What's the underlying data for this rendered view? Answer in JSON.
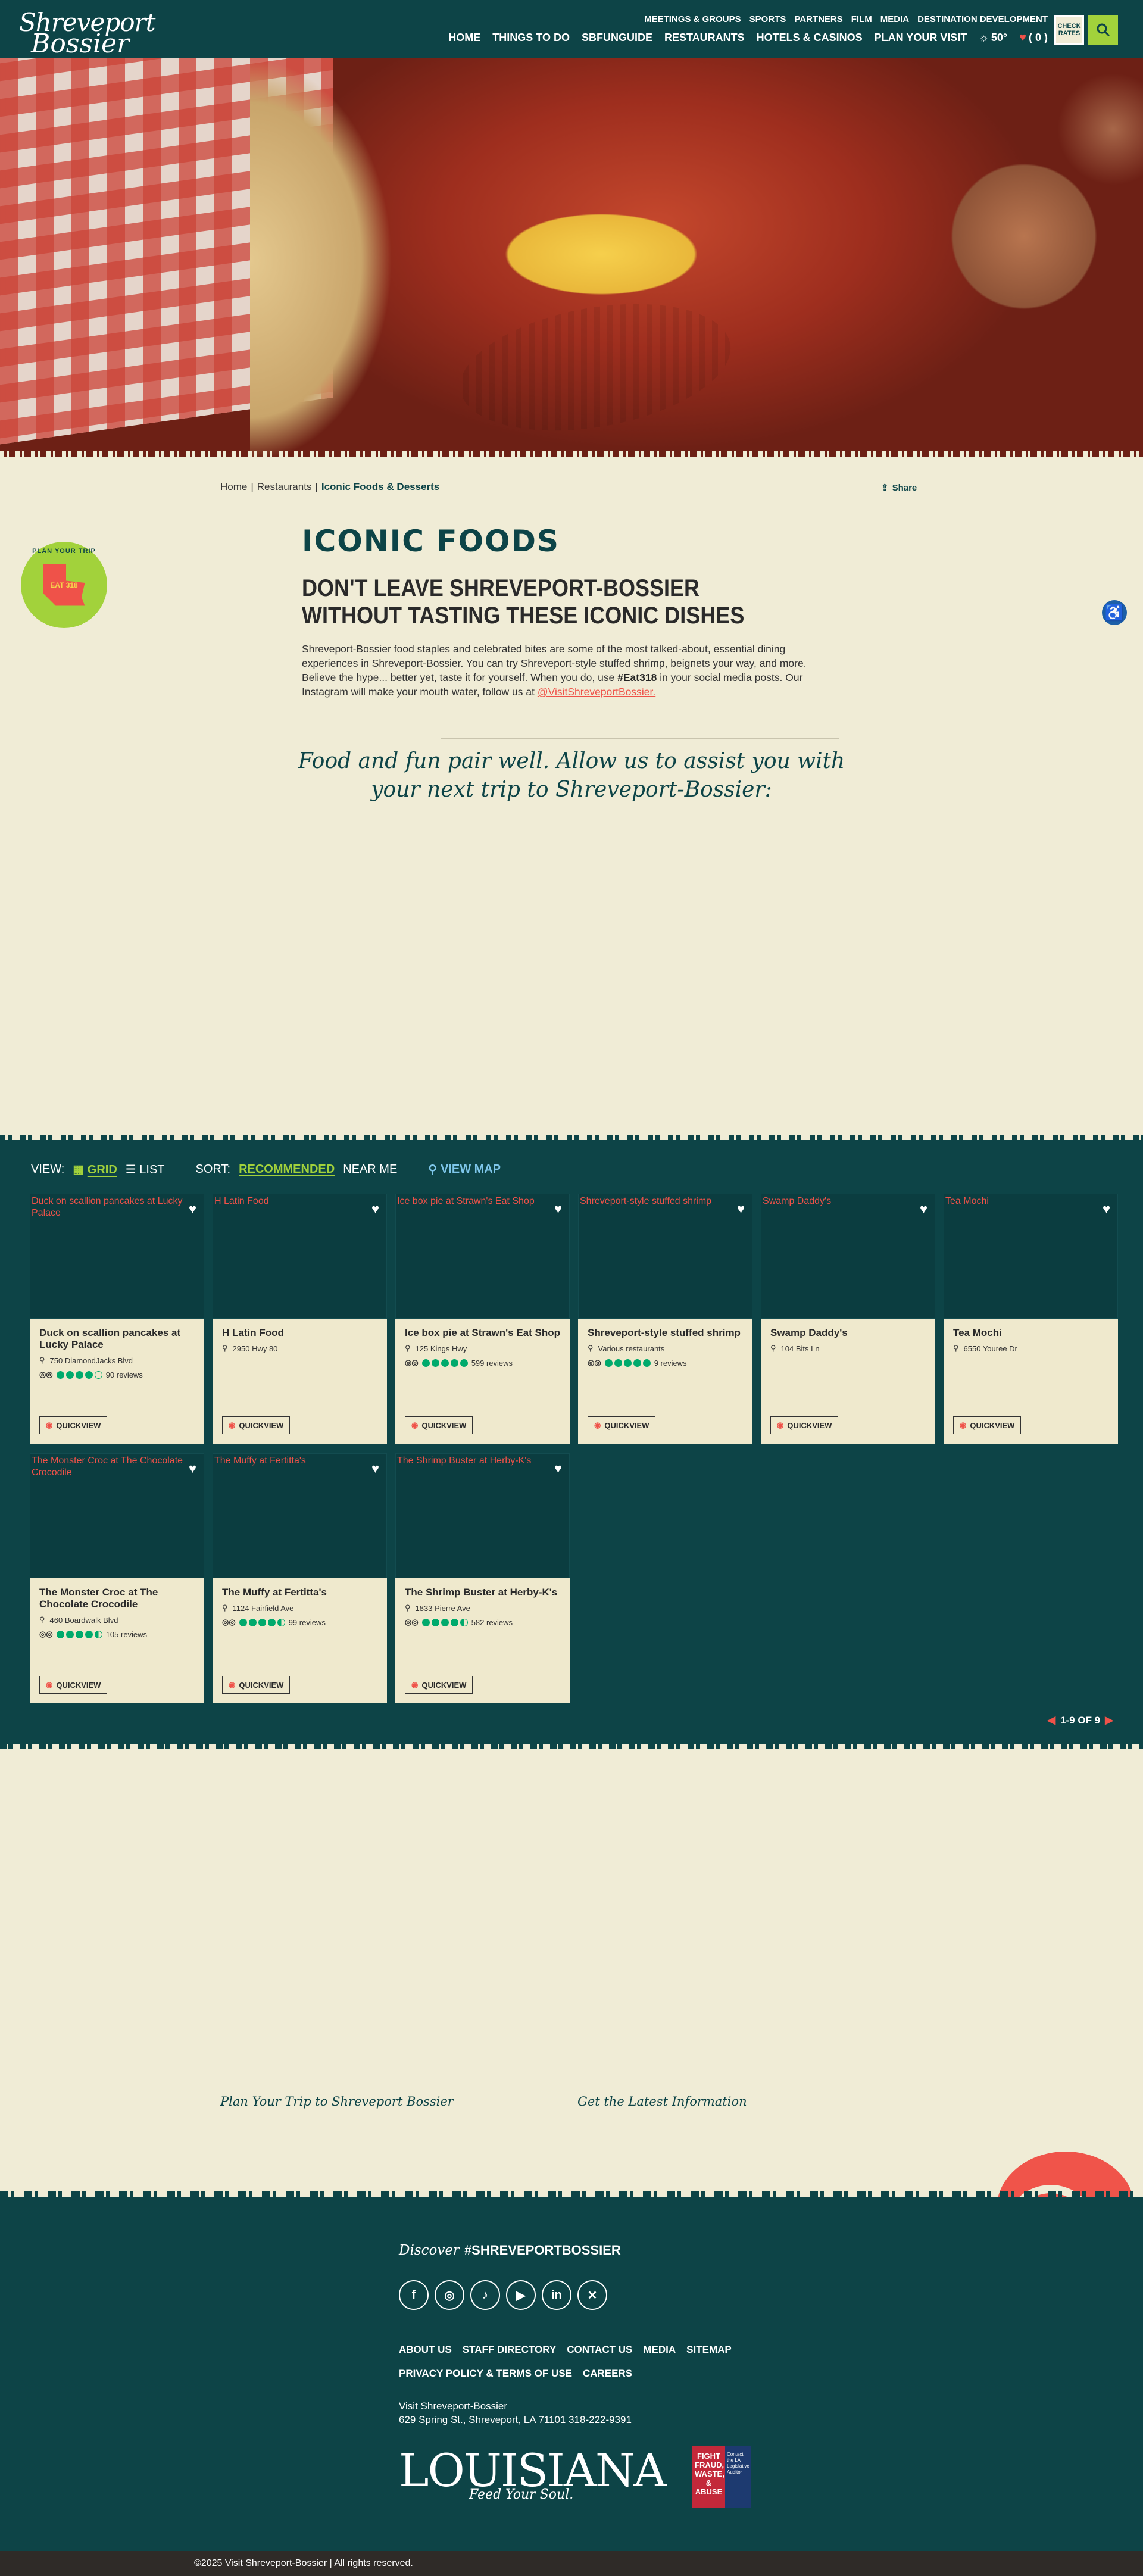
{
  "header": {
    "logo_line1": "Shreveport",
    "logo_line2": "Bossier",
    "top_links": [
      "MEETINGS & GROUPS",
      "SPORTS",
      "PARTNERS",
      "FILM",
      "MEDIA",
      "DESTINATION DEVELOPMENT"
    ],
    "main_links": [
      "HOME",
      "THINGS TO DO",
      "SBFUNGUIDE",
      "RESTAURANTS",
      "HOTELS & CASINOS",
      "PLAN YOUR VISIT"
    ],
    "weather": "50°",
    "favorites": "( 0 )",
    "check_rates": "CHECK RATES",
    "search_icon": "search-icon"
  },
  "breadcrumb": {
    "items": [
      "Home",
      "Restaurants"
    ],
    "current": "Iconic Foods & Desserts"
  },
  "share_label": "Share",
  "plan_badge": {
    "ring_text": "PLAN YOUR TRIP",
    "center_text": "EAT 318"
  },
  "page": {
    "title": "ICONIC FOODS",
    "subtitle": "DON'T LEAVE SHREVEPORT-BOSSIER WITHOUT TASTING THESE ICONIC DISHES",
    "intro_part1": "Shreveport-Bossier food staples and celebrated bites are some of the most talked-about, essential dining experiences in Shreveport-Bossier. You can try Shreveport-style stuffed shrimp, beignets your way, and more. Believe the hype... better yet, taste it for yourself. When you do, use ",
    "intro_hashtag": "#Eat318",
    "intro_part2": " in your social media posts. Our Instagram will make your mouth water, follow us at ",
    "intro_link": "@VisitShreveportBossier.",
    "tagline": "Food and fun pair well. Allow us to assist you with your next trip to Shreveport-Bossier:"
  },
  "listing": {
    "view_label": "VIEW:",
    "grid_label": "GRID",
    "list_label": "LIST",
    "sort_label": "SORT:",
    "recommended_label": "RECOMMENDED",
    "near_me_label": "NEAR ME",
    "view_map_label": "VIEW MAP",
    "quickview_label": "QUICKVIEW",
    "pagination": "1-9 OF 9",
    "cards": [
      {
        "img_alt": "Duck on scallion pancakes at Lucky Palace",
        "name": "Duck on scallion pancakes at Lucky Palace",
        "address": "750 DiamondJacks Blvd",
        "rating": 4.0,
        "reviews": "90 reviews"
      },
      {
        "img_alt": "H Latin Food",
        "name": "H Latin Food",
        "address": "2950 Hwy 80",
        "rating": null,
        "reviews": ""
      },
      {
        "img_alt": "Ice box pie at Strawn's Eat Shop",
        "name": "Ice box pie at Strawn's Eat Shop",
        "address": "125 Kings Hwy",
        "rating": 5.0,
        "reviews": "599 reviews"
      },
      {
        "img_alt": "Shreveport-style stuffed shrimp",
        "name": "Shreveport-style stuffed shrimp",
        "address": "Various restaurants",
        "rating": 5.0,
        "reviews": "9 reviews"
      },
      {
        "img_alt": "Swamp Daddy's",
        "name": "Swamp Daddy's",
        "address": "104 Bits Ln",
        "rating": null,
        "reviews": ""
      },
      {
        "img_alt": "Tea Mochi",
        "name": "Tea Mochi",
        "address": "6550 Youree Dr",
        "rating": null,
        "reviews": ""
      },
      {
        "img_alt": "The Monster Croc at The Chocolate Crocodile",
        "name": "The Monster Croc at The Chocolate Crocodile",
        "address": "460 Boardwalk Blvd",
        "rating": 4.5,
        "reviews": "105 reviews"
      },
      {
        "img_alt": "The Muffy at Fertitta's",
        "name": "The Muffy at Fertitta's",
        "address": "1124 Fairfield Ave",
        "rating": 4.5,
        "reviews": "99 reviews"
      },
      {
        "img_alt": "The Shrimp Buster at Herby-K's",
        "name": "The Shrimp Buster at Herby-K's",
        "address": "1833 Pierre Ave",
        "rating": 4.5,
        "reviews": "582 reviews"
      }
    ]
  },
  "plan_trip_heading": "Plan Your Trip to Shreveport Bossier",
  "latest_heading": "Get the Latest Information",
  "footer": {
    "discover_script": "Discover",
    "discover_tag": "#SHREVEPORTBOSSIER",
    "social": [
      "facebook-icon",
      "instagram-icon",
      "tiktok-icon",
      "youtube-icon",
      "linkedin-icon",
      "x-icon"
    ],
    "links_row1": [
      "ABOUT US",
      "STAFF DIRECTORY",
      "CONTACT US",
      "MEDIA",
      "SITEMAP"
    ],
    "links_row2": [
      "PRIVACY POLICY & TERMS OF USE",
      "CAREERS"
    ],
    "org_name": "Visit Shreveport-Bossier",
    "org_address": "629 Spring St., Shreveport, LA 71101 318-222-9391",
    "la_logo": "LOUISIANA",
    "la_slogan": "Feed Your Soul.",
    "fraud_text": "FIGHT FRAUD, WASTE, & ABUSE",
    "fraud_side": "Contact the LA Legislative Auditor",
    "copyright": "©2025 Visit Shreveport-Bossier | All rights reserved."
  },
  "colors": {
    "teal": "#0d4447",
    "cream": "#f0ecd6",
    "green": "#a2d23b",
    "red": "#ef5249",
    "tripadvisor_green": "#00aa6c"
  }
}
